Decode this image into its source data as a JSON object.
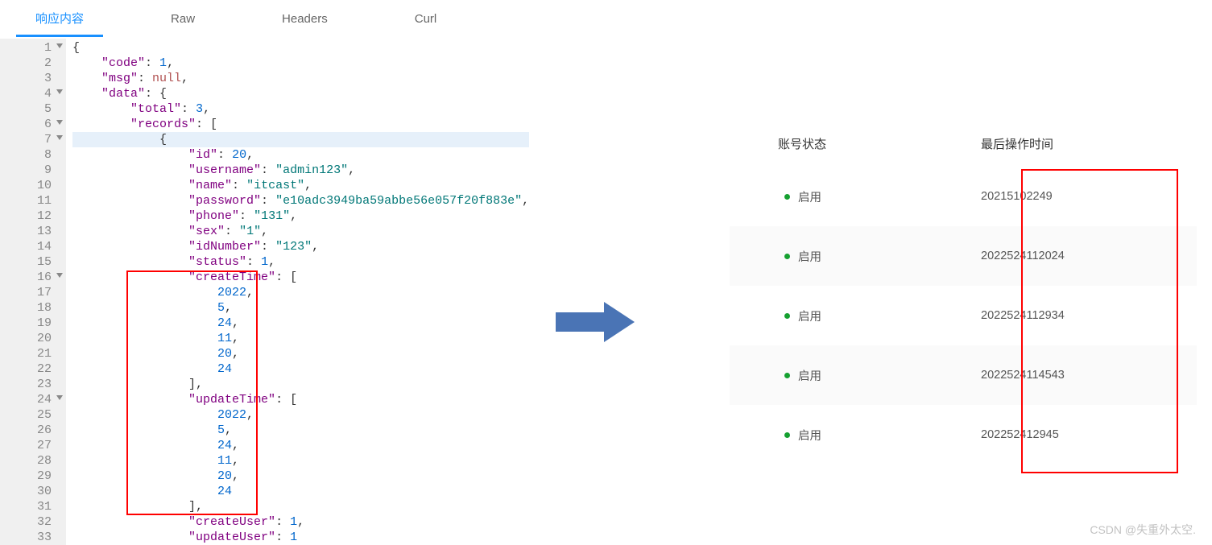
{
  "tabs": {
    "t0": "响应内容",
    "t1": "Raw",
    "t2": "Headers",
    "t3": "Curl"
  },
  "code": {
    "lines": [
      {
        "n": "1",
        "fold": true,
        "t": "{"
      },
      {
        "n": "2",
        "t": "    \"code\": 1,",
        "parts": [
          {
            "txt": "    "
          },
          {
            "txt": "\"code\"",
            "cls": "key"
          },
          {
            "txt": ": "
          },
          {
            "txt": "1",
            "cls": "num"
          },
          {
            "txt": ","
          }
        ]
      },
      {
        "n": "3",
        "t": "",
        "parts": [
          {
            "txt": "    "
          },
          {
            "txt": "\"msg\"",
            "cls": "key"
          },
          {
            "txt": ": "
          },
          {
            "txt": "null",
            "cls": "null"
          },
          {
            "txt": ","
          }
        ]
      },
      {
        "n": "4",
        "fold": true,
        "parts": [
          {
            "txt": "    "
          },
          {
            "txt": "\"data\"",
            "cls": "key"
          },
          {
            "txt": ": {"
          }
        ]
      },
      {
        "n": "5",
        "parts": [
          {
            "txt": "        "
          },
          {
            "txt": "\"total\"",
            "cls": "key"
          },
          {
            "txt": ": "
          },
          {
            "txt": "3",
            "cls": "num"
          },
          {
            "txt": ","
          }
        ]
      },
      {
        "n": "6",
        "fold": true,
        "parts": [
          {
            "txt": "        "
          },
          {
            "txt": "\"records\"",
            "cls": "key"
          },
          {
            "txt": ": ["
          }
        ]
      },
      {
        "n": "7",
        "fold": true,
        "hl": true,
        "parts": [
          {
            "txt": "            {"
          }
        ]
      },
      {
        "n": "8",
        "parts": [
          {
            "txt": "                "
          },
          {
            "txt": "\"id\"",
            "cls": "key"
          },
          {
            "txt": ": "
          },
          {
            "txt": "20",
            "cls": "num"
          },
          {
            "txt": ","
          }
        ]
      },
      {
        "n": "9",
        "parts": [
          {
            "txt": "                "
          },
          {
            "txt": "\"username\"",
            "cls": "key"
          },
          {
            "txt": ": "
          },
          {
            "txt": "\"admin123\"",
            "cls": "str"
          },
          {
            "txt": ","
          }
        ]
      },
      {
        "n": "10",
        "parts": [
          {
            "txt": "                "
          },
          {
            "txt": "\"name\"",
            "cls": "key"
          },
          {
            "txt": ": "
          },
          {
            "txt": "\"itcast\"",
            "cls": "str"
          },
          {
            "txt": ","
          }
        ]
      },
      {
        "n": "11",
        "parts": [
          {
            "txt": "                "
          },
          {
            "txt": "\"password\"",
            "cls": "key"
          },
          {
            "txt": ": "
          },
          {
            "txt": "\"e10adc3949ba59abbe56e057f20f883e\"",
            "cls": "str"
          },
          {
            "txt": ","
          }
        ]
      },
      {
        "n": "12",
        "parts": [
          {
            "txt": "                "
          },
          {
            "txt": "\"phone\"",
            "cls": "key"
          },
          {
            "txt": ": "
          },
          {
            "txt": "\"131\"",
            "cls": "str"
          },
          {
            "txt": ","
          }
        ]
      },
      {
        "n": "13",
        "parts": [
          {
            "txt": "                "
          },
          {
            "txt": "\"sex\"",
            "cls": "key"
          },
          {
            "txt": ": "
          },
          {
            "txt": "\"1\"",
            "cls": "str"
          },
          {
            "txt": ","
          }
        ]
      },
      {
        "n": "14",
        "parts": [
          {
            "txt": "                "
          },
          {
            "txt": "\"idNumber\"",
            "cls": "key"
          },
          {
            "txt": ": "
          },
          {
            "txt": "\"123\"",
            "cls": "str"
          },
          {
            "txt": ","
          }
        ]
      },
      {
        "n": "15",
        "parts": [
          {
            "txt": "                "
          },
          {
            "txt": "\"status\"",
            "cls": "key"
          },
          {
            "txt": ": "
          },
          {
            "txt": "1",
            "cls": "num"
          },
          {
            "txt": ","
          }
        ]
      },
      {
        "n": "16",
        "fold": true,
        "parts": [
          {
            "txt": "                "
          },
          {
            "txt": "\"createTime\"",
            "cls": "key"
          },
          {
            "txt": ": ["
          }
        ]
      },
      {
        "n": "17",
        "parts": [
          {
            "txt": "                    "
          },
          {
            "txt": "2022",
            "cls": "num"
          },
          {
            "txt": ","
          }
        ]
      },
      {
        "n": "18",
        "parts": [
          {
            "txt": "                    "
          },
          {
            "txt": "5",
            "cls": "num"
          },
          {
            "txt": ","
          }
        ]
      },
      {
        "n": "19",
        "parts": [
          {
            "txt": "                    "
          },
          {
            "txt": "24",
            "cls": "num"
          },
          {
            "txt": ","
          }
        ]
      },
      {
        "n": "20",
        "parts": [
          {
            "txt": "                    "
          },
          {
            "txt": "11",
            "cls": "num"
          },
          {
            "txt": ","
          }
        ]
      },
      {
        "n": "21",
        "parts": [
          {
            "txt": "                    "
          },
          {
            "txt": "20",
            "cls": "num"
          },
          {
            "txt": ","
          }
        ]
      },
      {
        "n": "22",
        "parts": [
          {
            "txt": "                    "
          },
          {
            "txt": "24",
            "cls": "num"
          }
        ]
      },
      {
        "n": "23",
        "parts": [
          {
            "txt": "                ],"
          }
        ]
      },
      {
        "n": "24",
        "fold": true,
        "parts": [
          {
            "txt": "                "
          },
          {
            "txt": "\"updateTime\"",
            "cls": "key"
          },
          {
            "txt": ": ["
          }
        ]
      },
      {
        "n": "25",
        "parts": [
          {
            "txt": "                    "
          },
          {
            "txt": "2022",
            "cls": "num"
          },
          {
            "txt": ","
          }
        ]
      },
      {
        "n": "26",
        "parts": [
          {
            "txt": "                    "
          },
          {
            "txt": "5",
            "cls": "num"
          },
          {
            "txt": ","
          }
        ]
      },
      {
        "n": "27",
        "parts": [
          {
            "txt": "                    "
          },
          {
            "txt": "24",
            "cls": "num"
          },
          {
            "txt": ","
          }
        ]
      },
      {
        "n": "28",
        "parts": [
          {
            "txt": "                    "
          },
          {
            "txt": "11",
            "cls": "num"
          },
          {
            "txt": ","
          }
        ]
      },
      {
        "n": "29",
        "parts": [
          {
            "txt": "                    "
          },
          {
            "txt": "20",
            "cls": "num"
          },
          {
            "txt": ","
          }
        ]
      },
      {
        "n": "30",
        "parts": [
          {
            "txt": "                    "
          },
          {
            "txt": "24",
            "cls": "num"
          }
        ]
      },
      {
        "n": "31",
        "parts": [
          {
            "txt": "                ],"
          }
        ]
      },
      {
        "n": "32",
        "parts": [
          {
            "txt": "                "
          },
          {
            "txt": "\"createUser\"",
            "cls": "key"
          },
          {
            "txt": ": "
          },
          {
            "txt": "1",
            "cls": "num"
          },
          {
            "txt": ","
          }
        ]
      },
      {
        "n": "33",
        "parts": [
          {
            "txt": "                "
          },
          {
            "txt": "\"updateUser\"",
            "cls": "key"
          },
          {
            "txt": ": "
          },
          {
            "txt": "1",
            "cls": "num"
          }
        ]
      }
    ]
  },
  "table": {
    "header_status": "账号状态",
    "header_time": "最后操作时间",
    "status_label": "启用",
    "rows": [
      {
        "time": "20215102249"
      },
      {
        "time": "2022524112024"
      },
      {
        "time": "2022524112934"
      },
      {
        "time": "2022524114543"
      },
      {
        "time": "202252412945"
      }
    ]
  },
  "watermark": "CSDN @失重外太空."
}
